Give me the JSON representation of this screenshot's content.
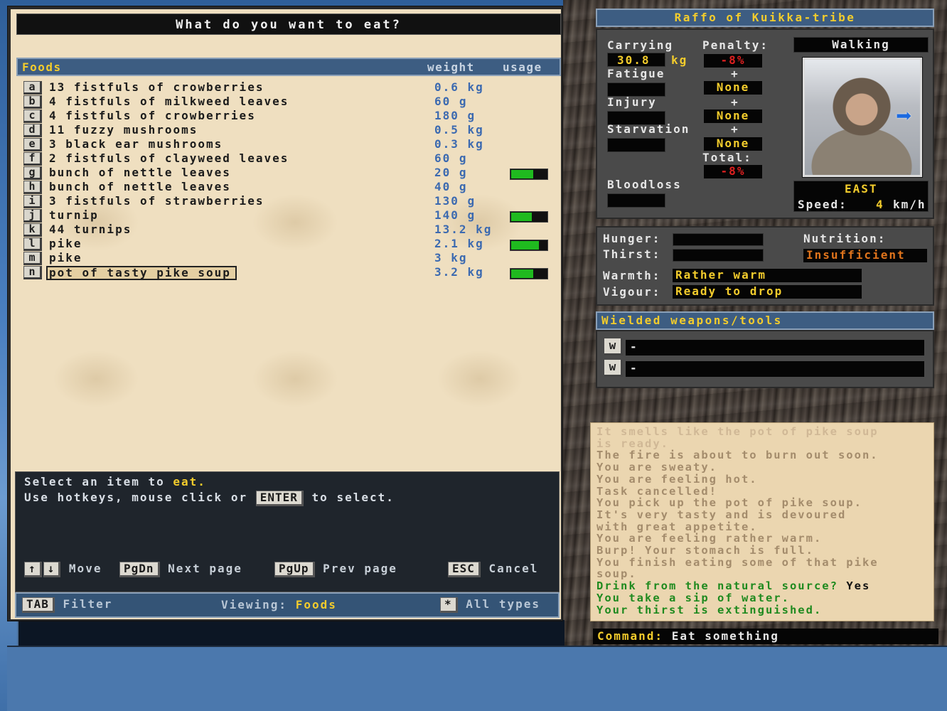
{
  "dialog": {
    "title": "What do you want to eat?",
    "list_header": {
      "category": "Foods",
      "weight": "weight",
      "usage": "usage"
    },
    "items": [
      {
        "key": "a",
        "name": "13 fistfuls of crowberries",
        "weight": "0.6 kg",
        "usage": null
      },
      {
        "key": "b",
        "name": "4 fistfuls of milkweed leaves",
        "weight": "60 g",
        "usage": null
      },
      {
        "key": "c",
        "name": "4 fistfuls of crowberries",
        "weight": "180 g",
        "usage": null
      },
      {
        "key": "d",
        "name": "11 fuzzy mushrooms",
        "weight": "0.5 kg",
        "usage": null
      },
      {
        "key": "e",
        "name": "3 black ear mushrooms",
        "weight": "0.3 kg",
        "usage": null
      },
      {
        "key": "f",
        "name": "2 fistfuls of clayweed leaves",
        "weight": "60 g",
        "usage": null
      },
      {
        "key": "g",
        "name": "bunch of nettle leaves",
        "weight": "20 g",
        "usage": 0.6
      },
      {
        "key": "h",
        "name": "bunch of nettle leaves",
        "weight": "40 g",
        "usage": null
      },
      {
        "key": "i",
        "name": "3 fistfuls of strawberries",
        "weight": "130 g",
        "usage": null
      },
      {
        "key": "j",
        "name": "turnip",
        "weight": "140 g",
        "usage": 0.55
      },
      {
        "key": "k",
        "name": "44 turnips",
        "weight": "13.2 kg",
        "usage": null
      },
      {
        "key": "l",
        "name": "pike",
        "weight": "2.1 kg",
        "usage": 0.75
      },
      {
        "key": "m",
        "name": "pike",
        "weight": "3 kg",
        "usage": null
      },
      {
        "key": "n",
        "name": "pot of tasty pike soup",
        "weight": "3.2 kg",
        "usage": 0.6,
        "selected": true
      }
    ],
    "help": {
      "line1_pre": "Select an item to ",
      "line1_action": "eat.",
      "line2_pre": "Use hotkeys, mouse click or",
      "line2_key": "ENTER",
      "line2_post": "to select."
    },
    "nav": {
      "up_key": "↑",
      "down_key": "↓",
      "move_label": "Move",
      "pgdn_key": "PgDn",
      "pgdn_label": "Next page",
      "pgup_key": "PgUp",
      "pgup_label": "Prev page",
      "esc_key": "ESC",
      "esc_label": "Cancel"
    },
    "filter": {
      "tab_key": "TAB",
      "tab_label": "Filter",
      "viewing_label": "Viewing:",
      "viewing_value": "Foods",
      "all_key": "*",
      "all_label": "All types"
    }
  },
  "character": {
    "name": "Raffo of Kuikka-tribe",
    "carrying_label": "Carrying",
    "carrying_value": "30.8",
    "carrying_unit": "kg",
    "penalty_label": "Penalty:",
    "penalty_carry": "-8%",
    "fatigue_label": "Fatigue",
    "fatigue_penalty": "None",
    "injury_label": "Injury",
    "injury_penalty": "None",
    "starvation_label": "Starvation",
    "starvation_penalty": "None",
    "plus": "+",
    "total_label": "Total:",
    "total_value": "-8%",
    "bloodloss_label": "Bloodloss",
    "movement": "Walking",
    "direction": "EAST",
    "speed_label": "Speed:",
    "speed_value": "4",
    "speed_unit": "km/h"
  },
  "needs": {
    "hunger_label": "Hunger:",
    "thirst_label": "Thirst:",
    "nutrition_label": "Nutrition:",
    "nutrition_value": "Insufficient",
    "warmth_label": "Warmth:",
    "warmth_value": "Rather warm",
    "vigour_label": "Vigour:",
    "vigour_value": "Ready to drop"
  },
  "weapons": {
    "title": "Wielded weapons/tools",
    "slots": [
      {
        "key": "w",
        "value": "-"
      },
      {
        "key": "w",
        "value": "-"
      }
    ]
  },
  "log": [
    {
      "text": "It smells like the pot of pike soup",
      "tone": "faint"
    },
    {
      "text": "is ready.",
      "tone": "faint"
    },
    {
      "text": "The fire is about to burn out soon.",
      "tone": "mid"
    },
    {
      "text": "You are sweaty.",
      "tone": "mid"
    },
    {
      "text": "You are feeling hot.",
      "tone": "mid"
    },
    {
      "text": "Task cancelled!",
      "tone": "mid"
    },
    {
      "text": "You pick up the pot of pike soup.",
      "tone": "mid"
    },
    {
      "text": "It's very tasty and is devoured",
      "tone": "mid"
    },
    {
      "text": "with great appetite.",
      "tone": "mid"
    },
    {
      "text": "You are feeling rather warm.",
      "tone": "mid"
    },
    {
      "text": "Burp! Your stomach is full.",
      "tone": "mid"
    },
    {
      "text": "You finish eating some of that pike",
      "tone": "mid"
    },
    {
      "text": "soup.",
      "tone": "mid"
    },
    {
      "text": "Drink from the natural source?",
      "tone": "grn",
      "answer": "Yes"
    },
    {
      "text": "You take a sip of water.",
      "tone": "grn"
    },
    {
      "text": "Your thirst is extinguished.",
      "tone": "grn"
    }
  ],
  "command": {
    "label": "Command:",
    "value": "Eat something"
  },
  "colors": {
    "accent_yellow": "#f3cc2c",
    "header_blue": "#3d5d82",
    "usage_green": "#1fba1f",
    "weight_blue": "#3c6ab0"
  }
}
